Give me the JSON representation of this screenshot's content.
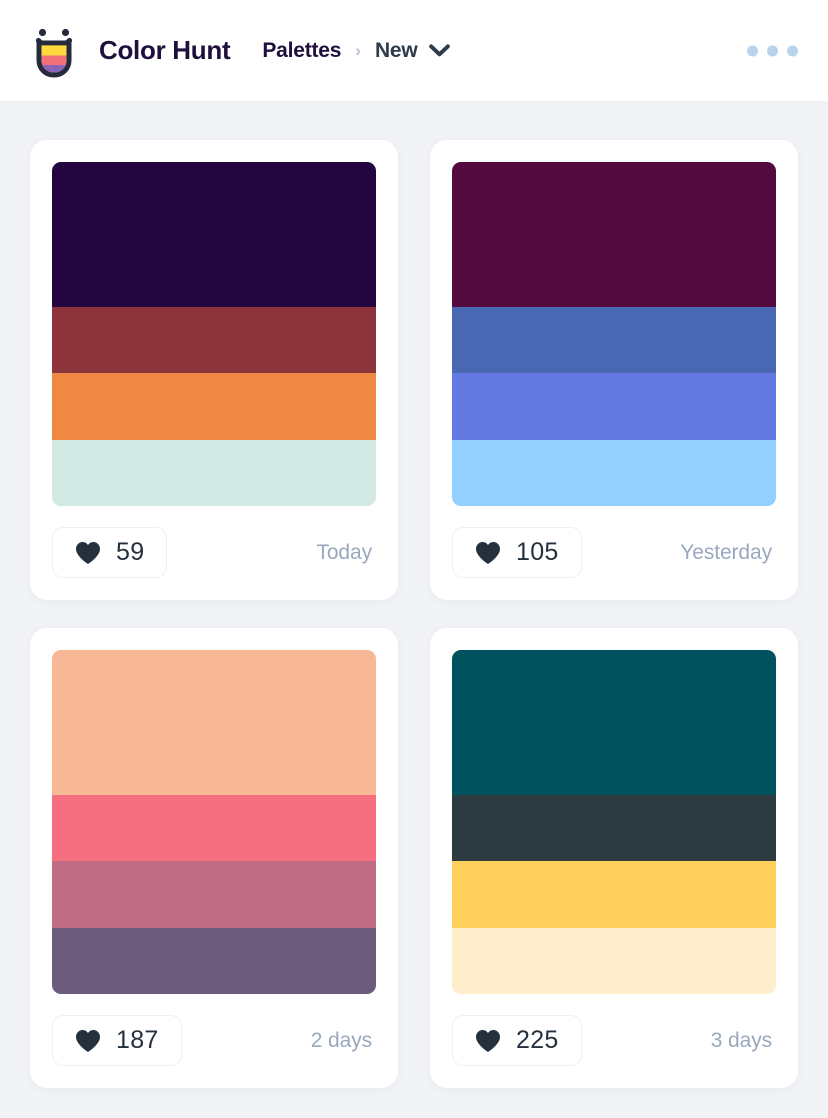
{
  "header": {
    "brand_name": "Color Hunt",
    "logo_icon": "color-hunt-logo-icon",
    "breadcrumb": {
      "items": [
        {
          "label": "Palettes",
          "icon": ""
        },
        {
          "label": "New",
          "icon": "chevron-down-icon"
        }
      ],
      "separator": "›"
    },
    "more_menu_icon": "three-dots-icon"
  },
  "palettes": [
    {
      "colors": [
        "#230540",
        "#8D333B",
        "#EE8842",
        "#D2E8E3"
      ],
      "likes": "59",
      "age": "Today",
      "heart_icon": "heart-icon"
    },
    {
      "colors": [
        "#530A3F",
        "#4968B4",
        "#6579E2",
        "#93CFFF"
      ],
      "likes": "105",
      "age": "Yesterday",
      "heart_icon": "heart-icon"
    },
    {
      "colors": [
        "#F8B795",
        "#F66F80",
        "#C06C84",
        "#6C5B7B"
      ],
      "likes": "187",
      "age": "2 days",
      "heart_icon": "heart-icon"
    },
    {
      "colors": [
        "#00525F",
        "#2C3B40",
        "#FFD15C",
        "#FFEECB"
      ],
      "likes": "225",
      "age": "3 days",
      "heart_icon": "heart-icon"
    }
  ],
  "theme": {
    "page_bg": "#f1f3f7",
    "card_bg": "#ffffff",
    "brand_text": "#1f0f3c",
    "muted_text": "#9aa8bf",
    "dot_color": "#b9d2ee",
    "heart_color": "#25303f"
  }
}
